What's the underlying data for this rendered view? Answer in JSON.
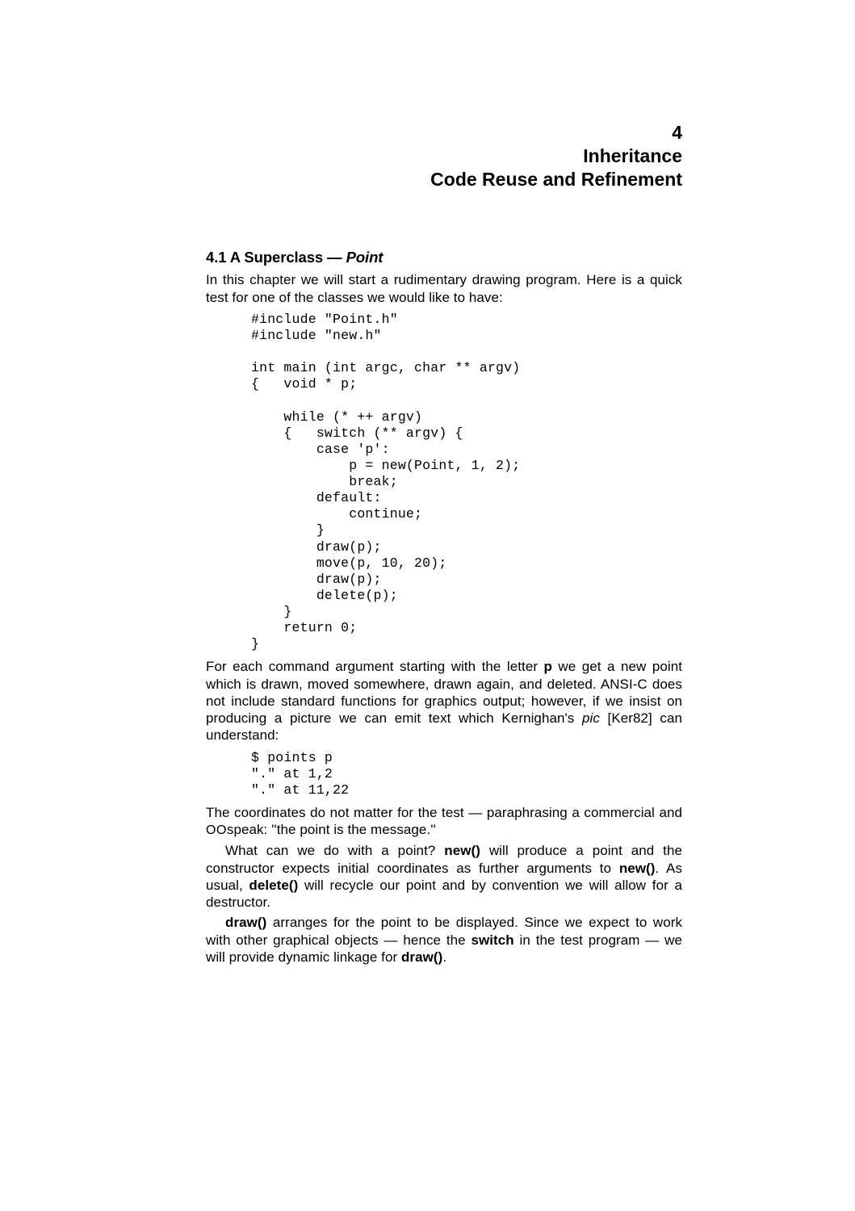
{
  "chapter": {
    "number": "4",
    "title_line1": "Inheritance",
    "title_line2": "Code Reuse and Refinement"
  },
  "section": {
    "number": "4.1",
    "title_prefix": "A Superclass —",
    "title_italic": "Point"
  },
  "para1": "In this chapter we will start a rudimentary drawing program.  Here is a quick test for one of the classes we would like to have:",
  "code1": "#include \"Point.h\"\n#include \"new.h\"\n\nint main (int argc, char ** argv)\n{   void * p;\n\n    while (* ++ argv)\n    {   switch (** argv) {\n        case 'p':\n            p = new(Point, 1, 2);\n            break;\n        default:\n            continue;\n        }\n        draw(p);\n        move(p, 10, 20);\n        draw(p);\n        delete(p);\n    }\n    return 0;\n}",
  "para2_a": "For each command argument starting with the letter ",
  "para2_bold_p": "p",
  "para2_b": " we get a new point which is drawn, moved somewhere, drawn again, and deleted.  ANSI-C does not include standard functions for graphics output; however, if we insist on producing a picture we can emit text which Kernighan's ",
  "para2_pic": "pic",
  "para2_c": " [Ker82] can understand:",
  "code2": "$ points p\n\".\" at 1,2\n\".\" at 11,22",
  "para3_a": "The coordinates do not matter for the test — paraphrasing a commercial and ",
  "para3_oo": "OO",
  "para3_b": "speak: ''the point is the message.''",
  "para4_a": "What can we do with a point?  ",
  "para4_new1": "new()",
  "para4_b": " will produce a point and the constructor expects initial coordinates as further arguments to ",
  "para4_new2": "new()",
  "para4_c": ". As usual, ",
  "para4_delete": "delete()",
  "para4_d": " will recycle our point and by convention we will allow for a destructor.",
  "para5_draw1": "draw()",
  "para5_a": " arranges for the point to be displayed.  Since we expect to work with other graphical objects — hence the ",
  "para5_switch": "switch",
  "para5_b": " in the test program — we will provide dynamic linkage for ",
  "para5_draw2": "draw()",
  "para5_c": "."
}
